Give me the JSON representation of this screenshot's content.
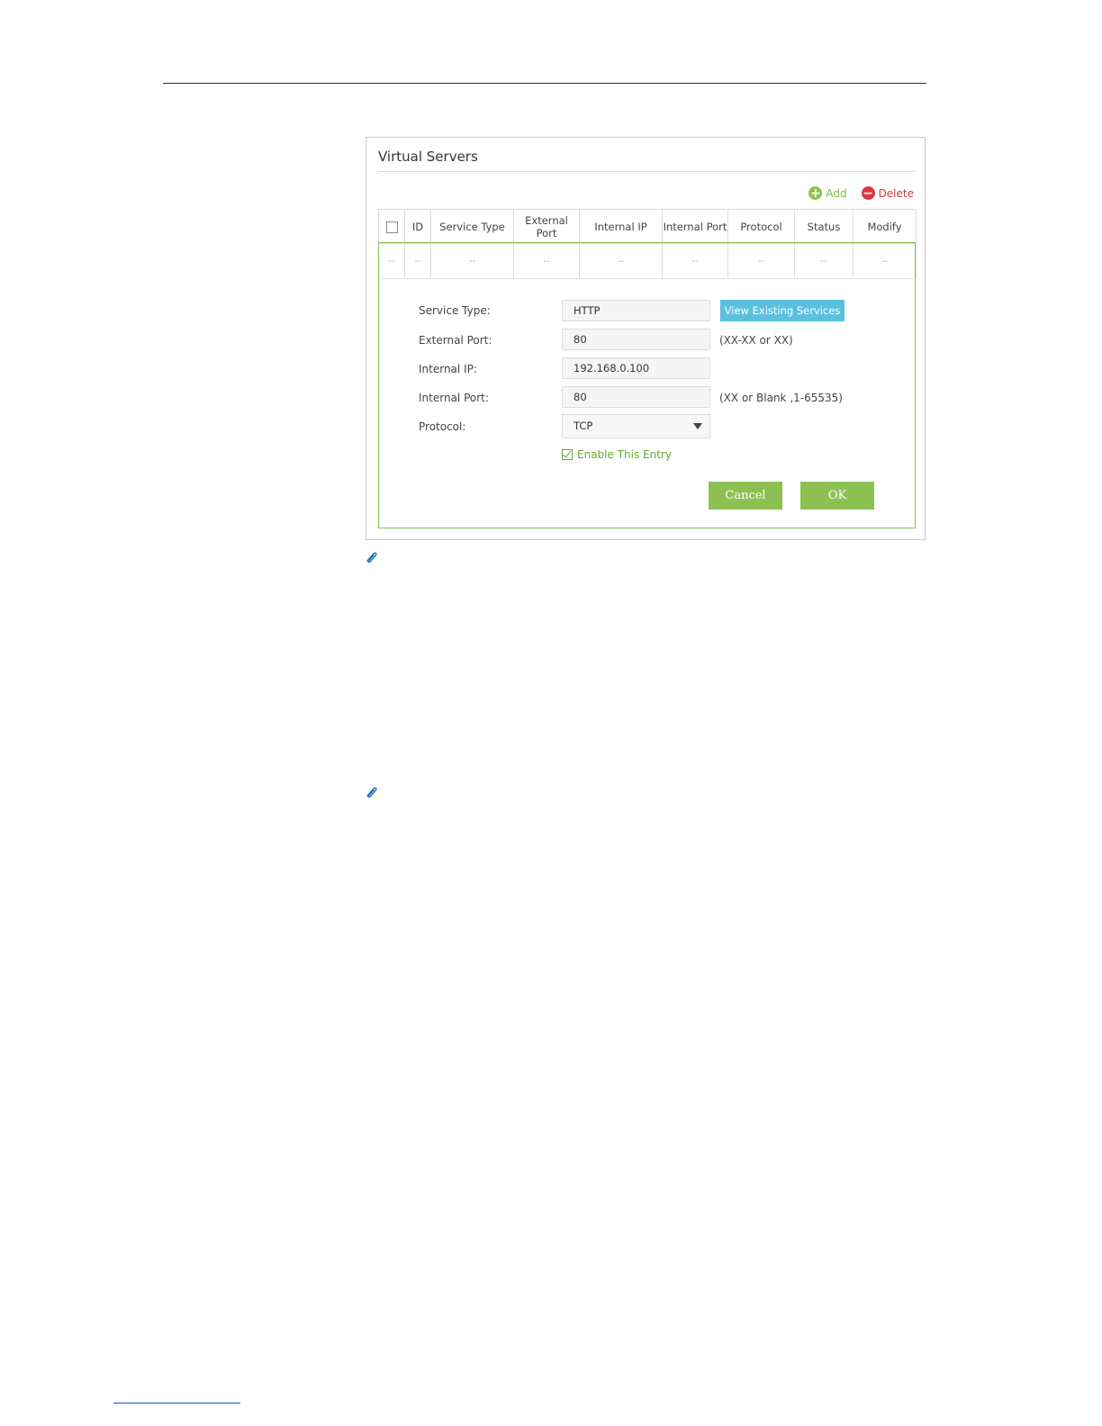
{
  "panel": {
    "title": "Virtual Servers",
    "toolbar": {
      "add_label": "Add",
      "delete_label": "Delete"
    },
    "table": {
      "headers": [
        "ID",
        "Service Type",
        "External Port",
        "Internal IP",
        "Internal Port",
        "Protocol",
        "Status",
        "Modify"
      ],
      "empty_row": [
        "--",
        "--",
        "--",
        "--",
        "--",
        "--",
        "--",
        "--",
        "--"
      ]
    },
    "form": {
      "service_type_label": "Service Type:",
      "service_type_value": "HTTP",
      "view_services_label": "View Existing Services",
      "external_port_label": "External Port:",
      "external_port_value": "80",
      "external_port_hint": "(XX-XX or XX)",
      "internal_ip_label": "Internal IP:",
      "internal_ip_value": "192.168.0.100",
      "internal_port_label": "Internal Port:",
      "internal_port_value": "80",
      "internal_port_hint": "(XX or Blank ,1-65535)",
      "protocol_label": "Protocol:",
      "protocol_value": "TCP",
      "enable_label": "Enable This Entry",
      "enable_checked": true,
      "cancel_label": "Cancel",
      "ok_label": "OK"
    }
  },
  "icons": {
    "add": "plus-circle-icon",
    "delete": "minus-circle-icon",
    "note": "paperclip-icon"
  },
  "colors": {
    "accent_green": "#8cc152",
    "view_button": "#5bc0de",
    "delete_red": "#d9363e",
    "note_blue": "#1e6fc0"
  }
}
